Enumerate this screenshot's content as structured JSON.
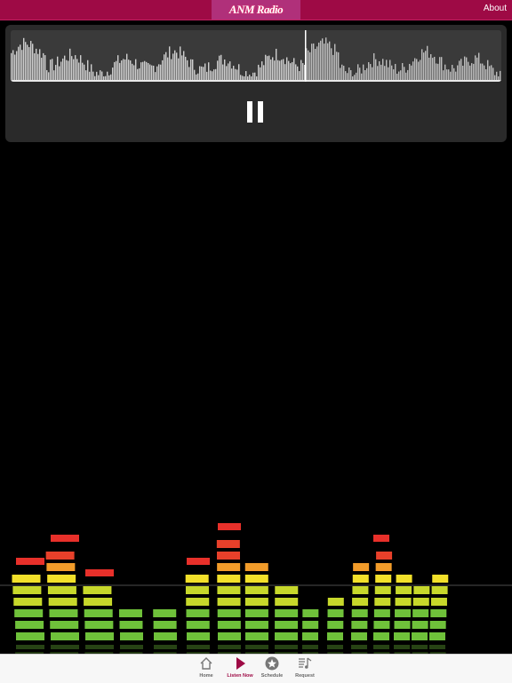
{
  "header": {
    "logo_text": "ANM Radio",
    "about_label": "About"
  },
  "player": {
    "state": "playing",
    "progress": 0.6
  },
  "tabbar": {
    "tabs": [
      {
        "label": "Home",
        "icon": "home-icon"
      },
      {
        "label": "Listen Now",
        "icon": "play-icon"
      },
      {
        "label": "Schedule",
        "icon": "star-icon"
      },
      {
        "label": "Request",
        "icon": "music-list-icon"
      }
    ],
    "active_index": 1
  },
  "colors": {
    "brand": "#9e0a45",
    "brand_light": "#b0307a",
    "panel": "#2a2a2a"
  }
}
